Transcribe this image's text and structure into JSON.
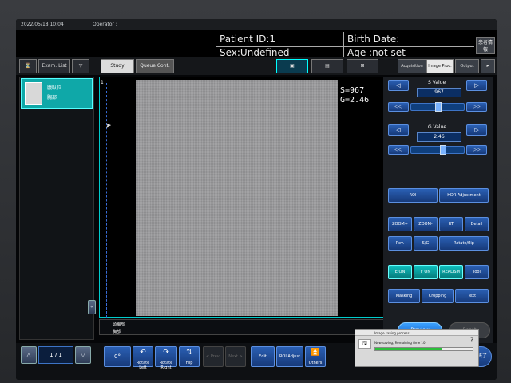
{
  "header": {
    "datetime": "2022/05/18 10:04",
    "operator_label": "Operator :",
    "patient_id": "Patient ID:1",
    "sex": "Sex:Undefined",
    "birth_date": "Birth Date:",
    "age": "Age :not set",
    "hospital_btn": "患者情報"
  },
  "tabs": {
    "exam_list": "Exam. List",
    "study": "Study",
    "queue_cont": "Queue Cont.",
    "acquisition": "Acquisition",
    "image_proc": "Image Proc.",
    "output": "Output"
  },
  "exam": {
    "name": "腹臥位",
    "sub": "胸部"
  },
  "viewer": {
    "frame_no": "1",
    "s_readout": "S=967",
    "g_readout": "G=2.46",
    "footer_line1": "頭胸部",
    "footer_line2": "胸部"
  },
  "s_value": {
    "label": "S Value",
    "value": "967",
    "level": 0.52
  },
  "g_value": {
    "label": "G Value",
    "value": "2.46",
    "level": 0.62
  },
  "proc_buttons": {
    "roi": "ROI",
    "hdr": "HDR Adjustment",
    "zoom_plus": "ZOOM+",
    "zoom_minus": "ZOOM-",
    "rt": "RT",
    "detail": "Detail",
    "rev": "Rev.",
    "sg": "S/G",
    "rotate_flip": "Rotate/flip",
    "e_on": "E ON",
    "f_on": "F ON",
    "realism": "REALISM",
    "tool": "Tool",
    "masking": "Masking",
    "cropping": "Cropping",
    "text": "Text"
  },
  "preview_label": "Preview",
  "reset_label": "Reset",
  "pager": {
    "value": "1 / 1"
  },
  "bottom": {
    "angle": "0°",
    "rotate_left": "Rotate Left",
    "rotate_right": "Rotate Right",
    "flip": "Flip",
    "prev": "< Prev.",
    "next": "Next >",
    "edit": "Edit",
    "roi_adjust": "ROI Adjust",
    "others": "Others",
    "end": "検査終了"
  },
  "dialog": {
    "title": "Image saving process",
    "message": "Now saving, Remaining time 10"
  }
}
